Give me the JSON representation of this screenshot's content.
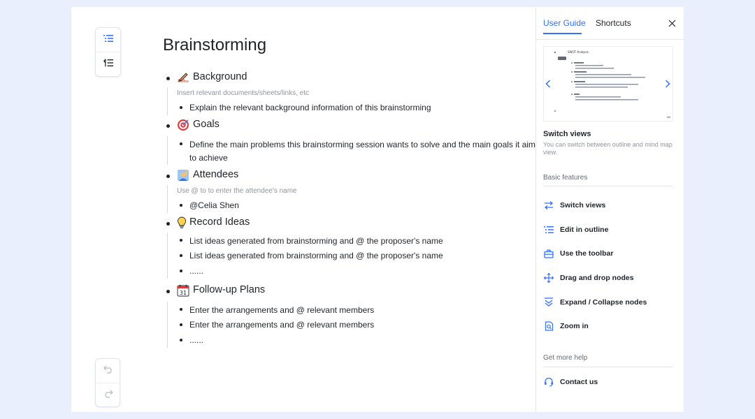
{
  "document": {
    "title": "Brainstorming",
    "sections": [
      {
        "label": "Background",
        "emoji_icon": "writing-hand-icon",
        "note": "Insert relevant documents/sheets/links, etc",
        "items": [
          "Explain the relevant background information of this brainstorming"
        ]
      },
      {
        "label": "Goals",
        "emoji_icon": "target-icon",
        "note": "",
        "items": [
          "Define the main problems this brainstorming session wants to solve and the main goals it aims to achieve"
        ]
      },
      {
        "label": "Attendees",
        "emoji_icon": "person-raising-hand-icon",
        "note": "Use @ to to enter the attendee's name",
        "items": [
          "@Celia Shen"
        ]
      },
      {
        "label": "Record Ideas",
        "emoji_icon": "light-bulb-icon",
        "note": "",
        "items": [
          "List ideas generated from brainstorming and @ the proposer's name",
          "List ideas generated from brainstorming and @ the proposer's name",
          "......"
        ]
      },
      {
        "label": "Follow-up Plans",
        "emoji_icon": "calendar-icon",
        "calendar_day": "31",
        "note": "",
        "items": [
          "Enter the arrangements and @ relevant members",
          "Enter the arrangements and @ relevant members",
          "......"
        ]
      }
    ]
  },
  "left_toolbar": {
    "top_icons": [
      "outline-view-icon",
      "collapse-outline-icon"
    ],
    "bottom_icons": [
      "undo-icon",
      "redo-icon"
    ]
  },
  "panel": {
    "tabs": [
      {
        "label": "User Guide",
        "active": true
      },
      {
        "label": "Shortcuts",
        "active": false
      }
    ],
    "preview": {
      "heading": "SWOT Analysis"
    },
    "current_feature": {
      "title": "Switch views",
      "description": "You can switch between outline and mind map view."
    },
    "basic_features_heading": "Basic features",
    "features": [
      {
        "label": "Switch views",
        "icon": "switch-arrows-icon"
      },
      {
        "label": "Edit in outline",
        "icon": "outline-list-icon"
      },
      {
        "label": "Use the toolbar",
        "icon": "toolbox-icon"
      },
      {
        "label": "Drag and drop nodes",
        "icon": "move-arrows-icon"
      },
      {
        "label": "Expand / Collapse nodes",
        "icon": "expand-collapse-icon"
      },
      {
        "label": "Zoom in",
        "icon": "zoom-doc-icon"
      }
    ],
    "help_heading": "Get more help",
    "contact_label": "Contact us",
    "contact_icon": "headset-icon"
  },
  "colors": {
    "accent": "#3370ff",
    "background": "#e9effd",
    "text": "#1f2329",
    "muted": "#8f959e"
  }
}
